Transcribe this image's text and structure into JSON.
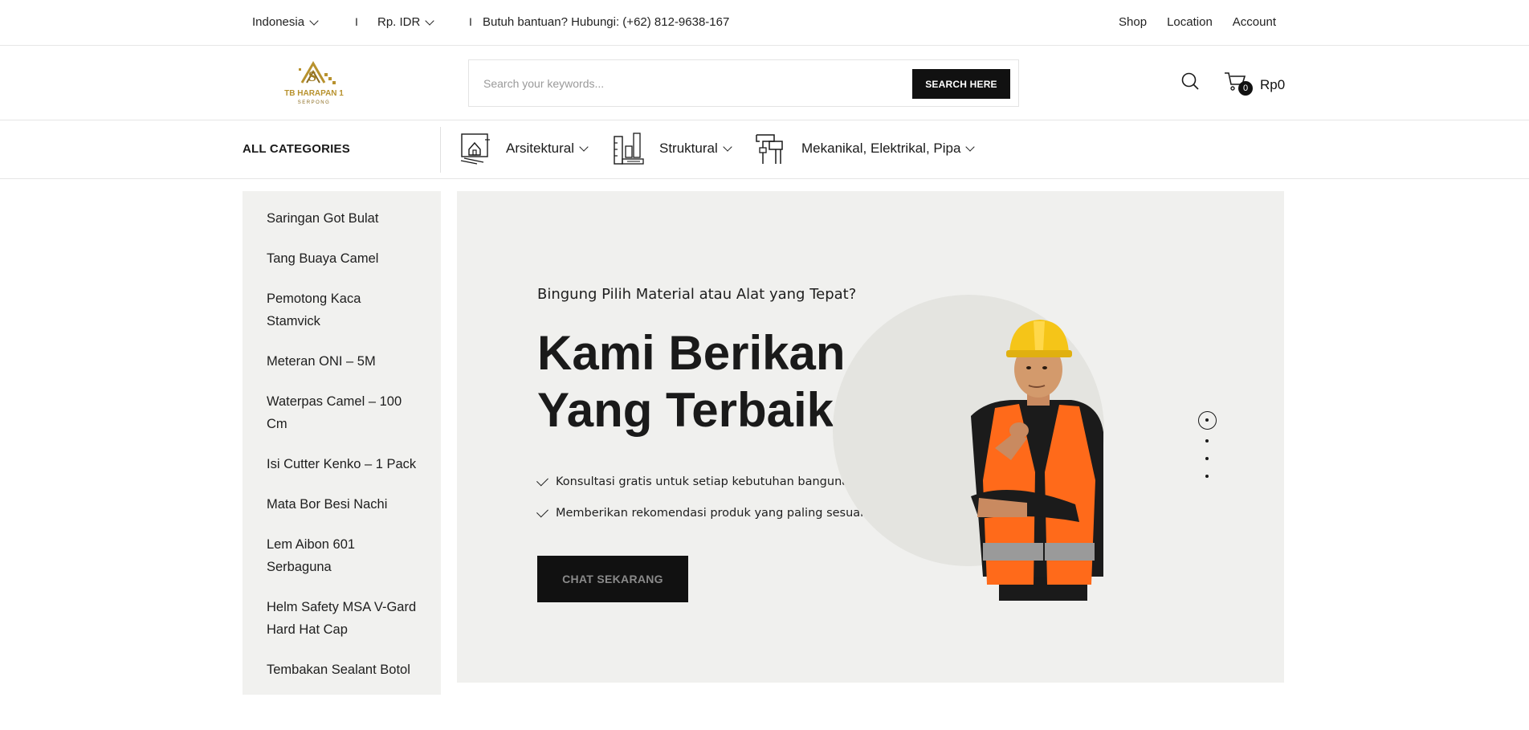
{
  "topbar": {
    "country": "Indonesia",
    "currency": "Rp. IDR",
    "separator": "I",
    "help_text": "Butuh bantuan? Hubungi: (+62) 812-9638-167",
    "nav": [
      "Shop",
      "Location",
      "Account"
    ]
  },
  "header": {
    "logo_text": "TB HARAPAN 1",
    "logo_subtext": "SERPONG",
    "search_placeholder": "Search your keywords...",
    "search_button": "SEARCH HERE",
    "cart_count": "0",
    "cart_total": "Rp0"
  },
  "categories": {
    "all_label": "ALL CATEGORIES",
    "items": [
      {
        "label": "Arsitektural",
        "icon": "architecture-icon"
      },
      {
        "label": "Struktural",
        "icon": "structural-icon"
      },
      {
        "label": "Mekanikal, Elektrikal, Pipa",
        "icon": "pipe-icon"
      }
    ]
  },
  "sidebar": {
    "items": [
      "Saringan Got Bulat",
      "Tang Buaya Camel",
      "Pemotong Kaca Stamvick",
      "Meteran ONI – 5M",
      "Waterpas Camel – 100 Cm",
      "Isi Cutter Kenko – 1 Pack",
      "Mata Bor Besi Nachi",
      "Lem Aibon 601 Serbaguna",
      "Helm Safety MSA V-Gard Hard Hat Cap",
      "Tembakan Sealant Botol"
    ]
  },
  "hero": {
    "subtitle": "Bingung Pilih Material atau Alat yang Tepat?",
    "headline": "Kami Berikan Yang Terbaik!",
    "features": [
      "Konsultasi gratis untuk setiap kebutuhan bangunan.",
      "Memberikan rekomendasi produk yang paling sesuai."
    ],
    "cta": "CHAT SEKARANG",
    "slides": 4,
    "active_slide": 1
  },
  "colors": {
    "dark": "#111111",
    "panel": "#f0f0ee",
    "logo_gold": "#b8922e",
    "helmet_yellow": "#f5c518",
    "vest_orange": "#ff6a1a"
  }
}
